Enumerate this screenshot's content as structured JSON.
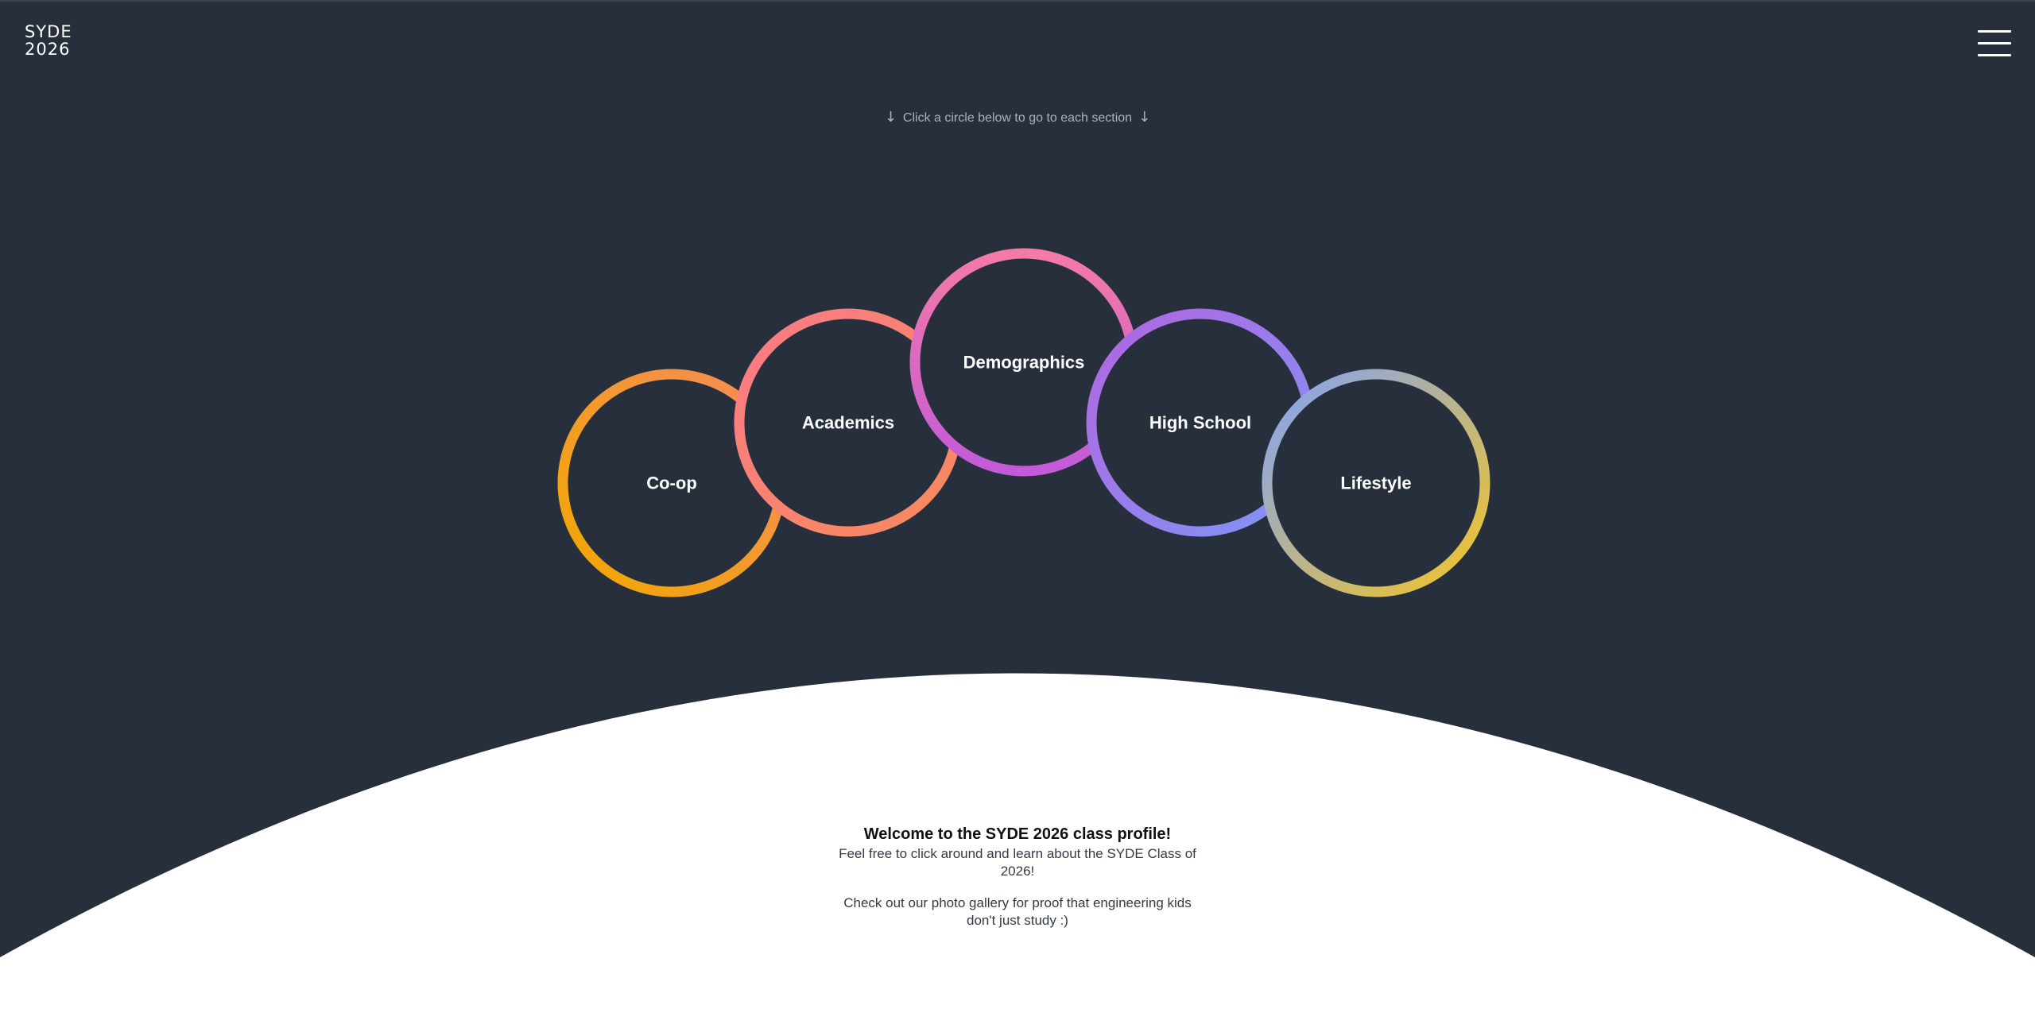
{
  "header": {
    "logo_line1": "SYDE",
    "logo_line2": "2026",
    "menu_icon": "hamburger-menu-icon"
  },
  "hint": {
    "text": "Click a circle below to go to each section",
    "arrow": "↓",
    "arrow_icon": "down-arrow-icon"
  },
  "sections": [
    {
      "label": "Co-op",
      "colors": [
        "#f2a900",
        "#f58a5a"
      ]
    },
    {
      "label": "Academics",
      "colors": [
        "#f97a86",
        "#f88b5c"
      ]
    },
    {
      "label": "Demographics",
      "colors": [
        "#f47aa8",
        "#c35ad8"
      ]
    },
    {
      "label": "High School",
      "colors": [
        "#b265e0",
        "#7f95f7"
      ]
    },
    {
      "label": "Lifestyle",
      "colors": [
        "#83a2f7",
        "#f2c625"
      ]
    }
  ],
  "welcome": {
    "title": "Welcome to the SYDE 2026 class profile!",
    "text1": "Feel free to click around and learn about the SYDE Class of 2026!",
    "text2": "Check out our photo gallery for proof that engineering kids don't just study :)"
  },
  "colors": {
    "background_dark": "#282f3c",
    "background_light": "#ffffff",
    "text_muted": "#aab0bc"
  }
}
